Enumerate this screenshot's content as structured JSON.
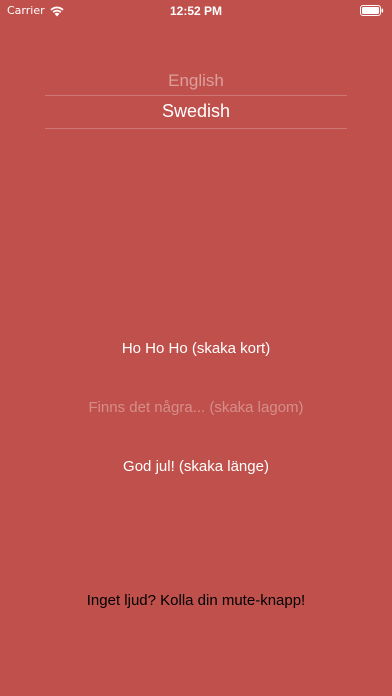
{
  "status_bar": {
    "carrier": "Carrier",
    "time": "12:52 PM"
  },
  "language_picker": {
    "options": [
      "English",
      "Swedish"
    ],
    "selected": "Swedish"
  },
  "greetings": [
    {
      "label": "Ho Ho Ho (skaka kort)",
      "enabled": true
    },
    {
      "label": "Finns det några... (skaka lagom)",
      "enabled": false
    },
    {
      "label": "God jul! (skaka länge)",
      "enabled": true
    }
  ],
  "footer": {
    "mute_hint": "Inget ljud? Kolla din mute-knapp!"
  },
  "colors": {
    "background": "#c0504b",
    "text": "#ffffff",
    "hint_text": "#000000"
  }
}
